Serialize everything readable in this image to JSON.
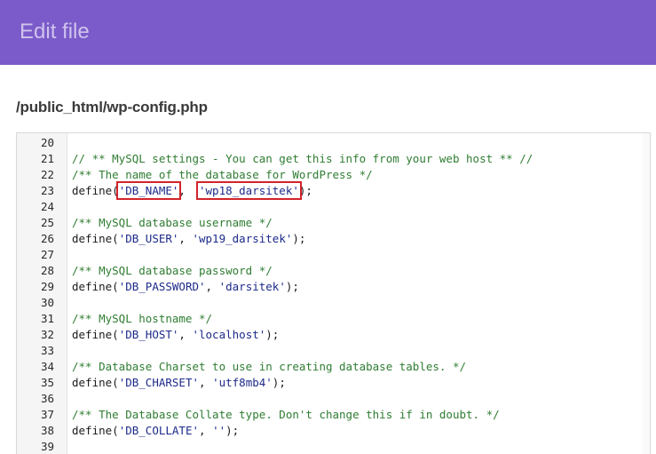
{
  "header": {
    "title": "Edit file"
  },
  "file": {
    "path": "/public_html/wp-config.php"
  },
  "editor": {
    "lines": [
      {
        "num": "20",
        "parts": []
      },
      {
        "num": "21",
        "parts": [
          {
            "t": "// ** MySQL settings - You can get this info from your web host ** //",
            "c": "cm"
          }
        ]
      },
      {
        "num": "22",
        "parts": [
          {
            "t": "/** The name of the database for WordPress */",
            "c": "cm"
          }
        ]
      },
      {
        "num": "23",
        "parts": [
          {
            "t": "define(",
            "c": "fn"
          },
          {
            "t": "'DB_NAME'",
            "c": "str",
            "hl": true
          },
          {
            "t": ",  ",
            "c": "fn"
          },
          {
            "t": "'wp18_darsitek'",
            "c": "str",
            "hl": true
          },
          {
            "t": ");",
            "c": "fn"
          }
        ]
      },
      {
        "num": "24",
        "parts": []
      },
      {
        "num": "25",
        "parts": [
          {
            "t": "/** MySQL database username */",
            "c": "cm"
          }
        ]
      },
      {
        "num": "26",
        "parts": [
          {
            "t": "define(",
            "c": "fn"
          },
          {
            "t": "'DB_USER'",
            "c": "str"
          },
          {
            "t": ", ",
            "c": "fn"
          },
          {
            "t": "'wp19_darsitek'",
            "c": "str"
          },
          {
            "t": ");",
            "c": "fn"
          }
        ]
      },
      {
        "num": "27",
        "parts": []
      },
      {
        "num": "28",
        "parts": [
          {
            "t": "/** MySQL database password */",
            "c": "cm"
          }
        ]
      },
      {
        "num": "29",
        "parts": [
          {
            "t": "define(",
            "c": "fn"
          },
          {
            "t": "'DB_PASSWORD'",
            "c": "str"
          },
          {
            "t": ", ",
            "c": "fn"
          },
          {
            "t": "'darsitek'",
            "c": "str"
          },
          {
            "t": ");",
            "c": "fn"
          }
        ]
      },
      {
        "num": "30",
        "parts": []
      },
      {
        "num": "31",
        "parts": [
          {
            "t": "/** MySQL hostname */",
            "c": "cm"
          }
        ]
      },
      {
        "num": "32",
        "parts": [
          {
            "t": "define(",
            "c": "fn"
          },
          {
            "t": "'DB_HOST'",
            "c": "str"
          },
          {
            "t": ", ",
            "c": "fn"
          },
          {
            "t": "'localhost'",
            "c": "str"
          },
          {
            "t": ");",
            "c": "fn"
          }
        ]
      },
      {
        "num": "33",
        "parts": []
      },
      {
        "num": "34",
        "parts": [
          {
            "t": "/** Database Charset to use in creating database tables. */",
            "c": "cm"
          }
        ]
      },
      {
        "num": "35",
        "parts": [
          {
            "t": "define(",
            "c": "fn"
          },
          {
            "t": "'DB_CHARSET'",
            "c": "str"
          },
          {
            "t": ", ",
            "c": "fn"
          },
          {
            "t": "'utf8mb4'",
            "c": "str"
          },
          {
            "t": ");",
            "c": "fn"
          }
        ]
      },
      {
        "num": "36",
        "parts": []
      },
      {
        "num": "37",
        "parts": [
          {
            "t": "/** The Database Collate type. Don't change this if in doubt. */",
            "c": "cm"
          }
        ]
      },
      {
        "num": "38",
        "parts": [
          {
            "t": "define(",
            "c": "fn"
          },
          {
            "t": "'DB_COLLATE'",
            "c": "str"
          },
          {
            "t": ", ",
            "c": "fn"
          },
          {
            "t": "''",
            "c": "str"
          },
          {
            "t": ");",
            "c": "fn"
          }
        ]
      },
      {
        "num": "39",
        "parts": []
      }
    ]
  },
  "colors": {
    "header_bg": "#7b5bc9",
    "highlight_box": "#d2232a",
    "comment": "#2f7d32",
    "string": "#1d2a8a"
  }
}
